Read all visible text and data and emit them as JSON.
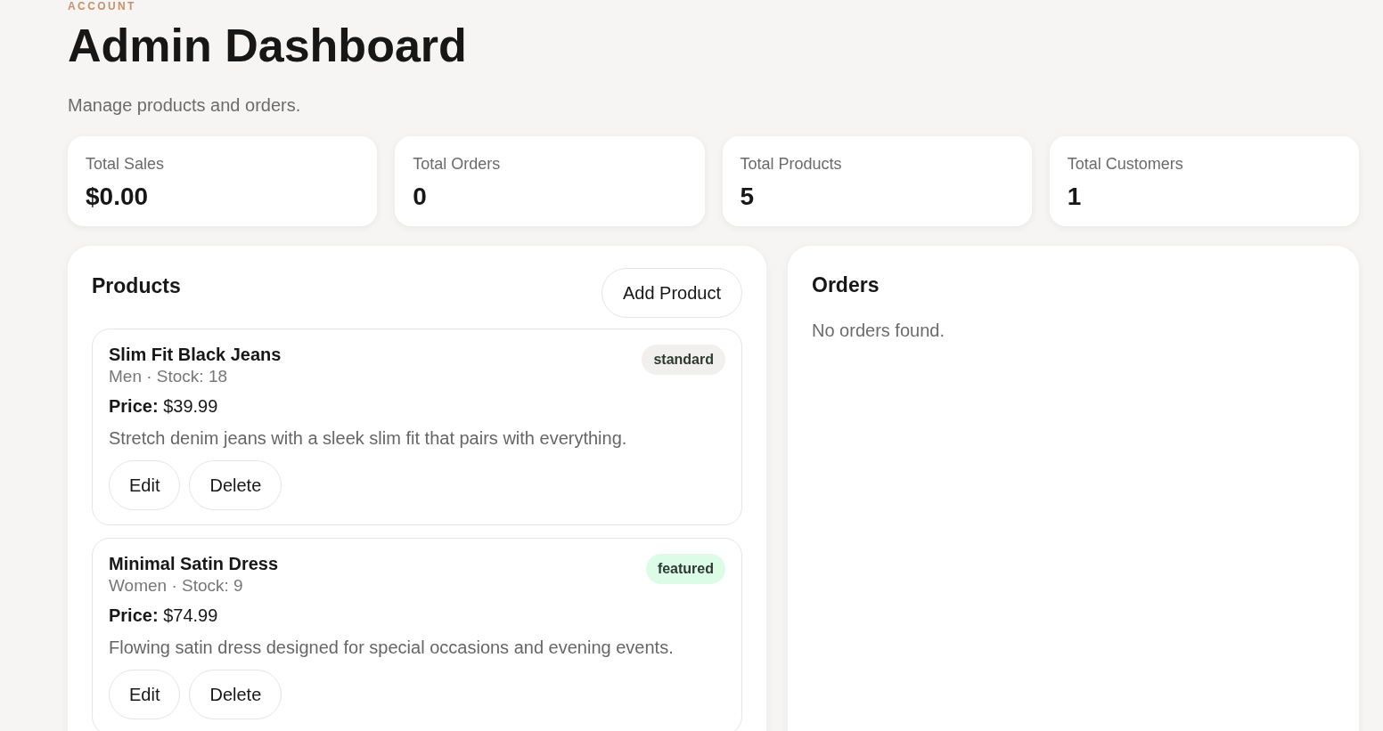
{
  "header": {
    "eyebrow": "ACCOUNT",
    "title": "Admin Dashboard",
    "subtitle": "Manage products and orders."
  },
  "stats": [
    {
      "label": "Total Sales",
      "value": "$0.00"
    },
    {
      "label": "Total Orders",
      "value": "0"
    },
    {
      "label": "Total Products",
      "value": "5"
    },
    {
      "label": "Total Customers",
      "value": "1"
    }
  ],
  "products": {
    "title": "Products",
    "add_button": "Add Product",
    "items": [
      {
        "name": "Slim Fit Black Jeans",
        "meta": "Men · Stock: 18",
        "tag": {
          "label": "standard",
          "color": "#f1f0ee"
        },
        "price": "**Price:** $39.99",
        "description": "Stretch denim jeans with a sleek slim fit that pairs with everything.",
        "actions": [
          "Edit",
          "Delete"
        ]
      },
      {
        "name": "Minimal Satin Dress",
        "meta": "Women · Stock: 9",
        "tag": {
          "label": "featured",
          "color": "#dcfce7"
        },
        "price": "**Price:** $74.99",
        "description": "Flowing satin dress designed for special occasions and evening events.",
        "actions": [
          "Edit",
          "Delete"
        ]
      }
    ]
  },
  "orders": {
    "title": "Orders",
    "empty": "No orders found."
  }
}
